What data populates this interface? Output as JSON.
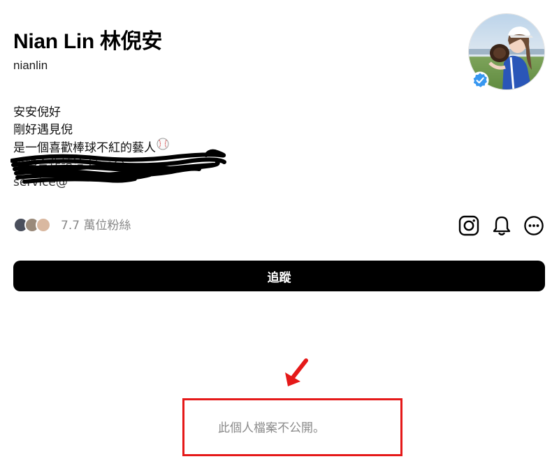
{
  "profile": {
    "display_name": "Nian Lin 林倪安",
    "handle": "nianlin",
    "verified": true
  },
  "bio": {
    "lines": [
      "安安倪好",
      "剛好遇見倪",
      "是一個喜歡棒球不紅的藝人"
    ],
    "line3_emoji": "baseball-icon",
    "obscured_line1": "聯絡合作請洽 Line@",
    "obscured_line2": "service@"
  },
  "followers": {
    "count_text": "7.7 萬位粉絲"
  },
  "actions": {
    "instagram_icon": "instagram-icon",
    "notification_icon": "bell-icon",
    "more_icon": "more-options-icon"
  },
  "follow_button": {
    "label": "追蹤"
  },
  "private_notice": {
    "text": "此個人檔案不公開。"
  },
  "colors": {
    "annotation_red": "#e51919",
    "button_black": "#000000",
    "verified_blue": "#3897f0",
    "muted_gray": "#8a8a8a"
  }
}
